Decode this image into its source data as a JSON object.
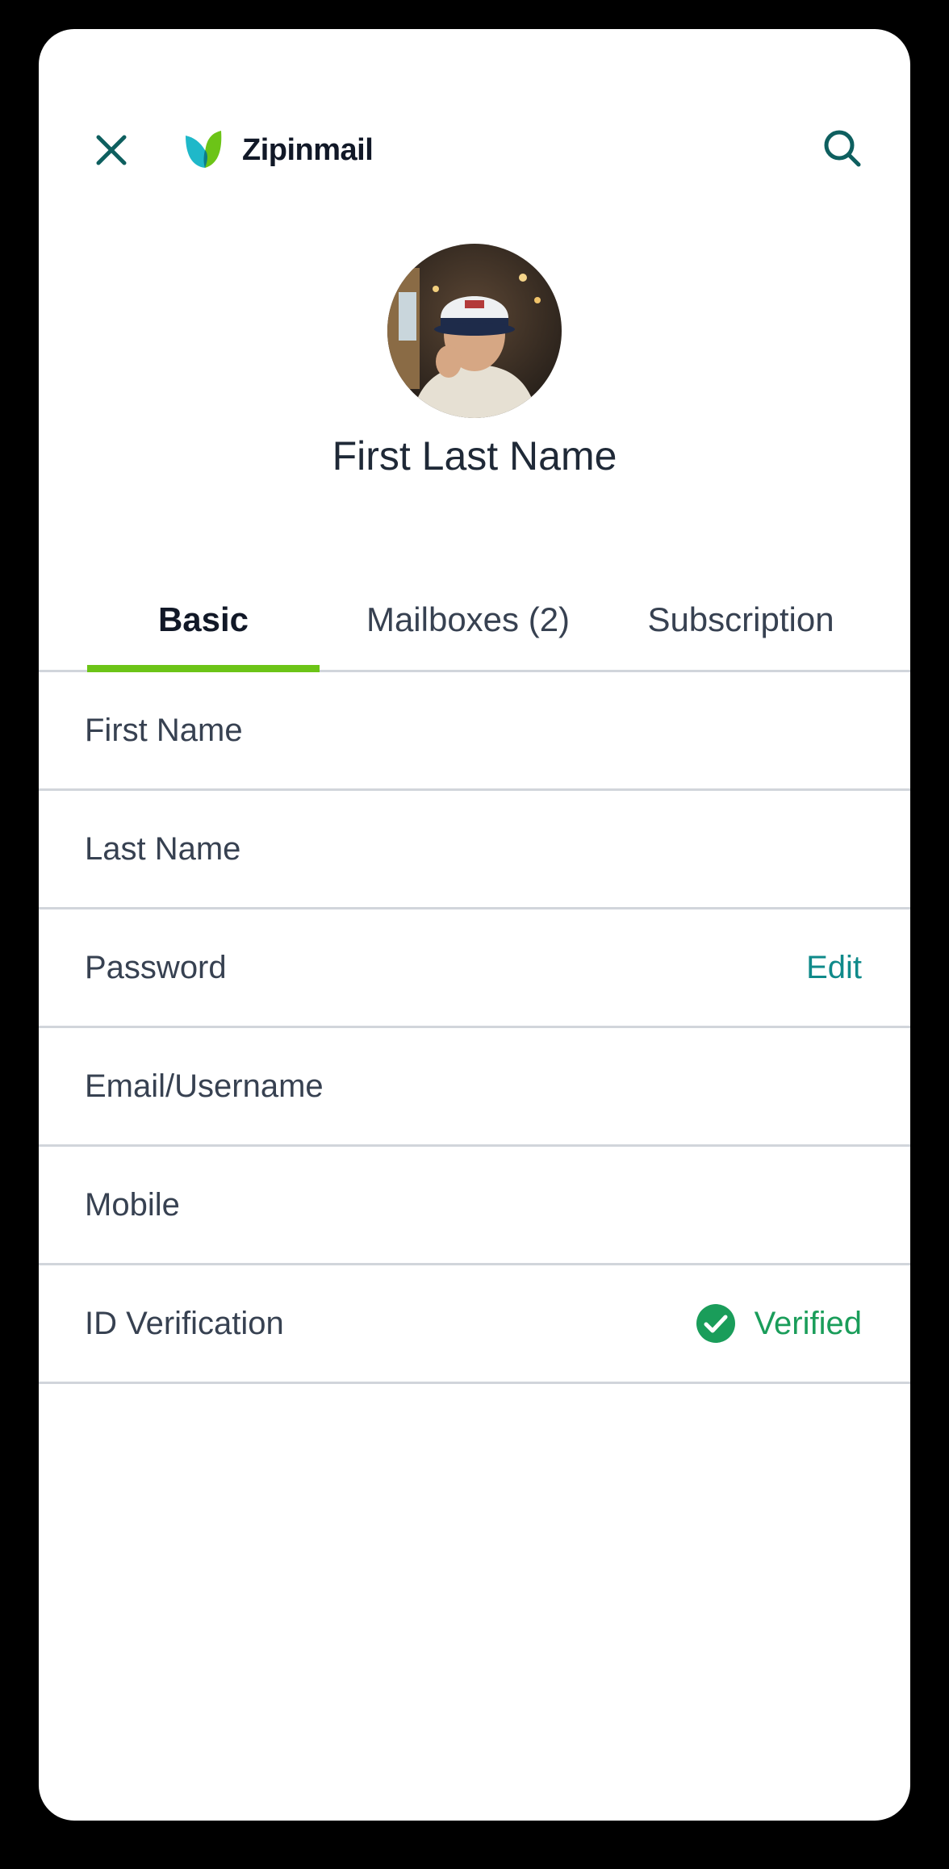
{
  "header": {
    "brand": "Zipinmail",
    "close_icon": "close-icon",
    "search_icon": "search-icon",
    "brand_colors": {
      "leaf_left": "#1fb8c9",
      "leaf_right": "#6cc417",
      "text": "#111827"
    }
  },
  "profile": {
    "name": "First Last Name",
    "avatar": "profile-photo"
  },
  "tabs": [
    {
      "label": "Basic",
      "active": true
    },
    {
      "label": "Mailboxes (2)",
      "active": false
    },
    {
      "label": "Subscription",
      "active": false
    }
  ],
  "rows": [
    {
      "label": "First Name"
    },
    {
      "label": "Last Name"
    },
    {
      "label": "Password",
      "action": "Edit"
    },
    {
      "label": "Email/Username"
    },
    {
      "label": "Mobile"
    },
    {
      "label": "ID Verification",
      "status": "Verified",
      "status_icon": "check-circle-icon"
    }
  ],
  "colors": {
    "accent": "#6cc417",
    "link": "#0f8a8a",
    "verified": "#1a9d5a",
    "icon": "#0e5f5f"
  }
}
